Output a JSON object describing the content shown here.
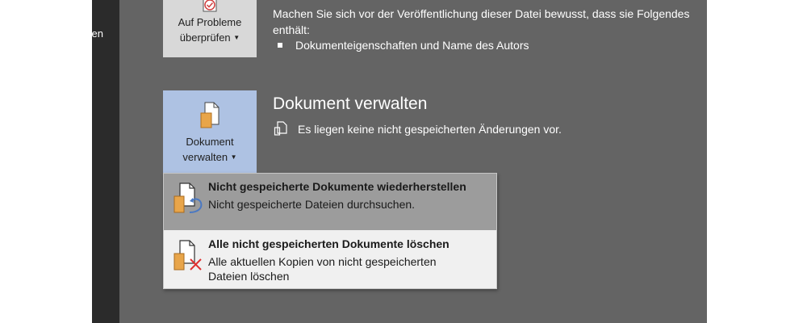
{
  "sidebar": {
    "partial_label": "en"
  },
  "check_button": {
    "line1": "Auf Probleme",
    "line2": "überprüfen"
  },
  "inspect_section": {
    "description": "Machen Sie sich vor der Veröffentlichung dieser Datei bewusst, dass sie Folgendes enthält:",
    "bullets": [
      "Dokumenteigenschaften und Name des Autors"
    ]
  },
  "manage_button": {
    "line1": "Dokument",
    "line2": "verwalten"
  },
  "manage_section": {
    "title": "Dokument verwalten",
    "status": "Es liegen keine nicht gespeicherten Änderungen vor."
  },
  "dropdown_menu": {
    "items": [
      {
        "title": "Nicht gespeicherte Dokumente wiederherstellen",
        "description": "Nicht gespeicherte Dateien durchsuchen.",
        "icon": "restore-document-icon",
        "hovered": true
      },
      {
        "title": "Alle nicht gespeicherten Dokumente löschen",
        "description": "Alle aktuellen Kopien von nicht gespeicherten Dateien löschen",
        "icon": "delete-documents-icon",
        "hovered": false
      }
    ]
  },
  "colors": {
    "backstage_bg": "#646464",
    "sidebar_bg": "#2b2b2b",
    "selected_button": "#aec2e3",
    "hover_item": "#9c9c9c",
    "menu_bg": "#f0f0f0",
    "delete_x": "#e03030",
    "restore_arrow": "#4a78c2",
    "doc_orange": "#e8a54a"
  }
}
